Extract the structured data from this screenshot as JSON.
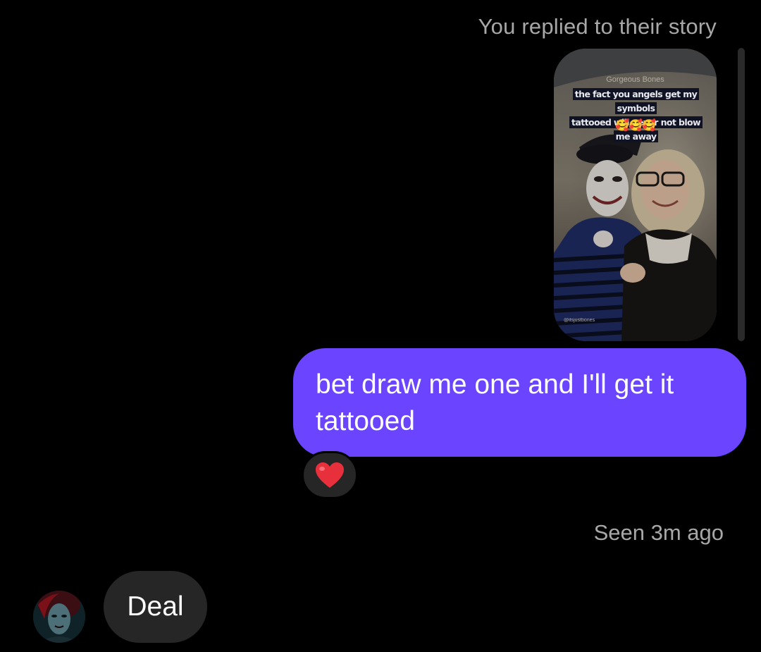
{
  "thread": {
    "reply_label": "You replied to their story",
    "story": {
      "account_name": "Gorgeous Bones",
      "caption_line1": "the fact you angels get my symbols",
      "caption_line2": "tattooed will never not blow me away",
      "caption_emoji": "🥰🥰🥰",
      "handle": "@itsjustbones"
    },
    "outgoing_message": {
      "text": "bet draw me one and I'll get it tattooed",
      "color": "#6b44ff"
    },
    "reaction": {
      "emoji": "heart-icon",
      "color": "#e8303c"
    },
    "seen_status": "Seen 3m ago",
    "incoming_message": {
      "text": "Deal",
      "sender_avatar": "profile-avatar"
    }
  },
  "colors": {
    "background": "#000000",
    "incoming_bubble": "#262626",
    "secondary_text": "#a8a8a8"
  }
}
